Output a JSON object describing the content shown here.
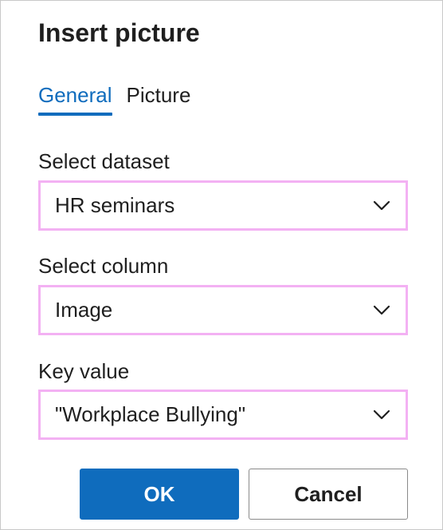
{
  "dialog": {
    "title": "Insert picture"
  },
  "tabs": [
    {
      "label": "General",
      "active": true
    },
    {
      "label": "Picture",
      "active": false
    }
  ],
  "fields": {
    "dataset": {
      "label": "Select dataset",
      "value": "HR seminars",
      "icon": "chevron-down-icon"
    },
    "column": {
      "label": "Select column",
      "value": "Image",
      "icon": "chevron-down-icon"
    },
    "key_value": {
      "label": "Key value",
      "value": "\"Workplace Bullying\"",
      "icon": "chevron-down-icon"
    }
  },
  "buttons": {
    "ok_label": "OK",
    "cancel_label": "Cancel"
  },
  "colors": {
    "accent": "#0f6cbd",
    "highlight_border": "#f3b1f3",
    "text": "#1f1f1f"
  }
}
